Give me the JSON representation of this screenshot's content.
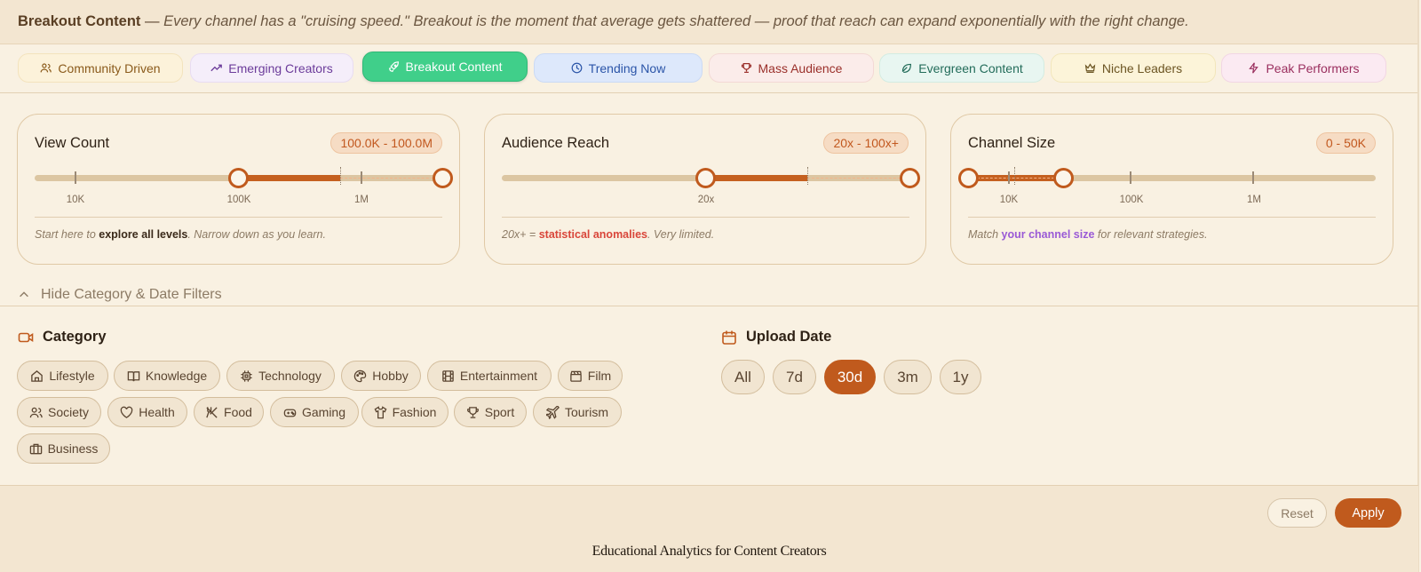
{
  "banner": {
    "title": "Breakout Content",
    "dash": " — ",
    "description": "Every channel has a \"cruising speed.\" Breakout is the moment that average gets shattered — proof that reach can expand exponentially with the right change."
  },
  "tabs": [
    {
      "label": "Community Driven",
      "icon": "users-icon",
      "bg": "#fcf2da",
      "border": "#f3e3bd",
      "color": "#8a5a1b"
    },
    {
      "label": "Emerging Creators",
      "icon": "trending-up-icon",
      "bg": "#f5eefa",
      "border": "#e8dcf2",
      "color": "#6b3b9a"
    },
    {
      "label": "Breakout Content",
      "icon": "rocket-icon",
      "active": true
    },
    {
      "label": "Trending Now",
      "icon": "clock-icon",
      "bg": "#dde8fb",
      "border": "#cbdaf5",
      "color": "#2b55a8"
    },
    {
      "label": "Mass Audience",
      "icon": "trophy-icon",
      "bg": "#fbecea",
      "border": "#f3d9d5",
      "color": "#9a2f2a"
    },
    {
      "label": "Evergreen Content",
      "icon": "leaf-icon",
      "bg": "#e8f6f1",
      "border": "#d3ece2",
      "color": "#236c5a"
    },
    {
      "label": "Niche Leaders",
      "icon": "crown-icon",
      "bg": "#fcf4d9",
      "border": "#f2e6bb",
      "color": "#6c5523"
    },
    {
      "label": "Peak Performers",
      "icon": "lightning-icon",
      "bg": "#fbeaf2",
      "border": "#f2d6e4",
      "color": "#9a2e5e"
    }
  ],
  "cards": {
    "view_count": {
      "title": "View Count",
      "range": "100.0K - 100.0M",
      "ticks": [
        "10K",
        "100K",
        "1M"
      ],
      "note_a": "Start here to ",
      "note_em": "explore all levels",
      "note_b": ". Narrow down as you learn.",
      "note_em_color": "#3b2a1a"
    },
    "audience_reach": {
      "title": "Audience Reach",
      "range": "20x - 100x+",
      "ticks": [
        "20x"
      ],
      "note_a": "20x+ = ",
      "note_em": "statistical anomalies",
      "note_b": ". Very limited.",
      "note_em_color": "#d9463a"
    },
    "channel_size": {
      "title": "Channel Size",
      "range": "0 - 50K",
      "ticks": [
        "10K",
        "100K",
        "1M"
      ],
      "note_a": "Match ",
      "note_em": "your channel size",
      "note_b": " for relevant strategies.",
      "note_em_color": "#9a5ad6"
    }
  },
  "toggle_label": "Hide Category & Date Filters",
  "category": {
    "title": "Category",
    "items": [
      {
        "label": "Lifestyle",
        "icon": "home-icon"
      },
      {
        "label": "Knowledge",
        "icon": "book-icon"
      },
      {
        "label": "Technology",
        "icon": "chip-icon"
      },
      {
        "label": "Hobby",
        "icon": "palette-icon"
      },
      {
        "label": "Entertainment",
        "icon": "film-strip-icon"
      },
      {
        "label": "Film",
        "icon": "clapperboard-icon"
      },
      {
        "label": "Society",
        "icon": "users-icon"
      },
      {
        "label": "Health",
        "icon": "heart-icon"
      },
      {
        "label": "Food",
        "icon": "utensils-icon"
      },
      {
        "label": "Gaming",
        "icon": "gamepad-icon"
      },
      {
        "label": "Fashion",
        "icon": "shirt-icon"
      },
      {
        "label": "Sport",
        "icon": "trophy-icon"
      },
      {
        "label": "Tourism",
        "icon": "plane-icon"
      },
      {
        "label": "Business",
        "icon": "briefcase-icon"
      }
    ]
  },
  "upload_date": {
    "title": "Upload Date",
    "options": [
      "All",
      "7d",
      "30d",
      "3m",
      "1y"
    ],
    "selected": "30d"
  },
  "actions": {
    "reset": "Reset",
    "apply": "Apply"
  },
  "footer": "Educational Analytics for Content Creators"
}
